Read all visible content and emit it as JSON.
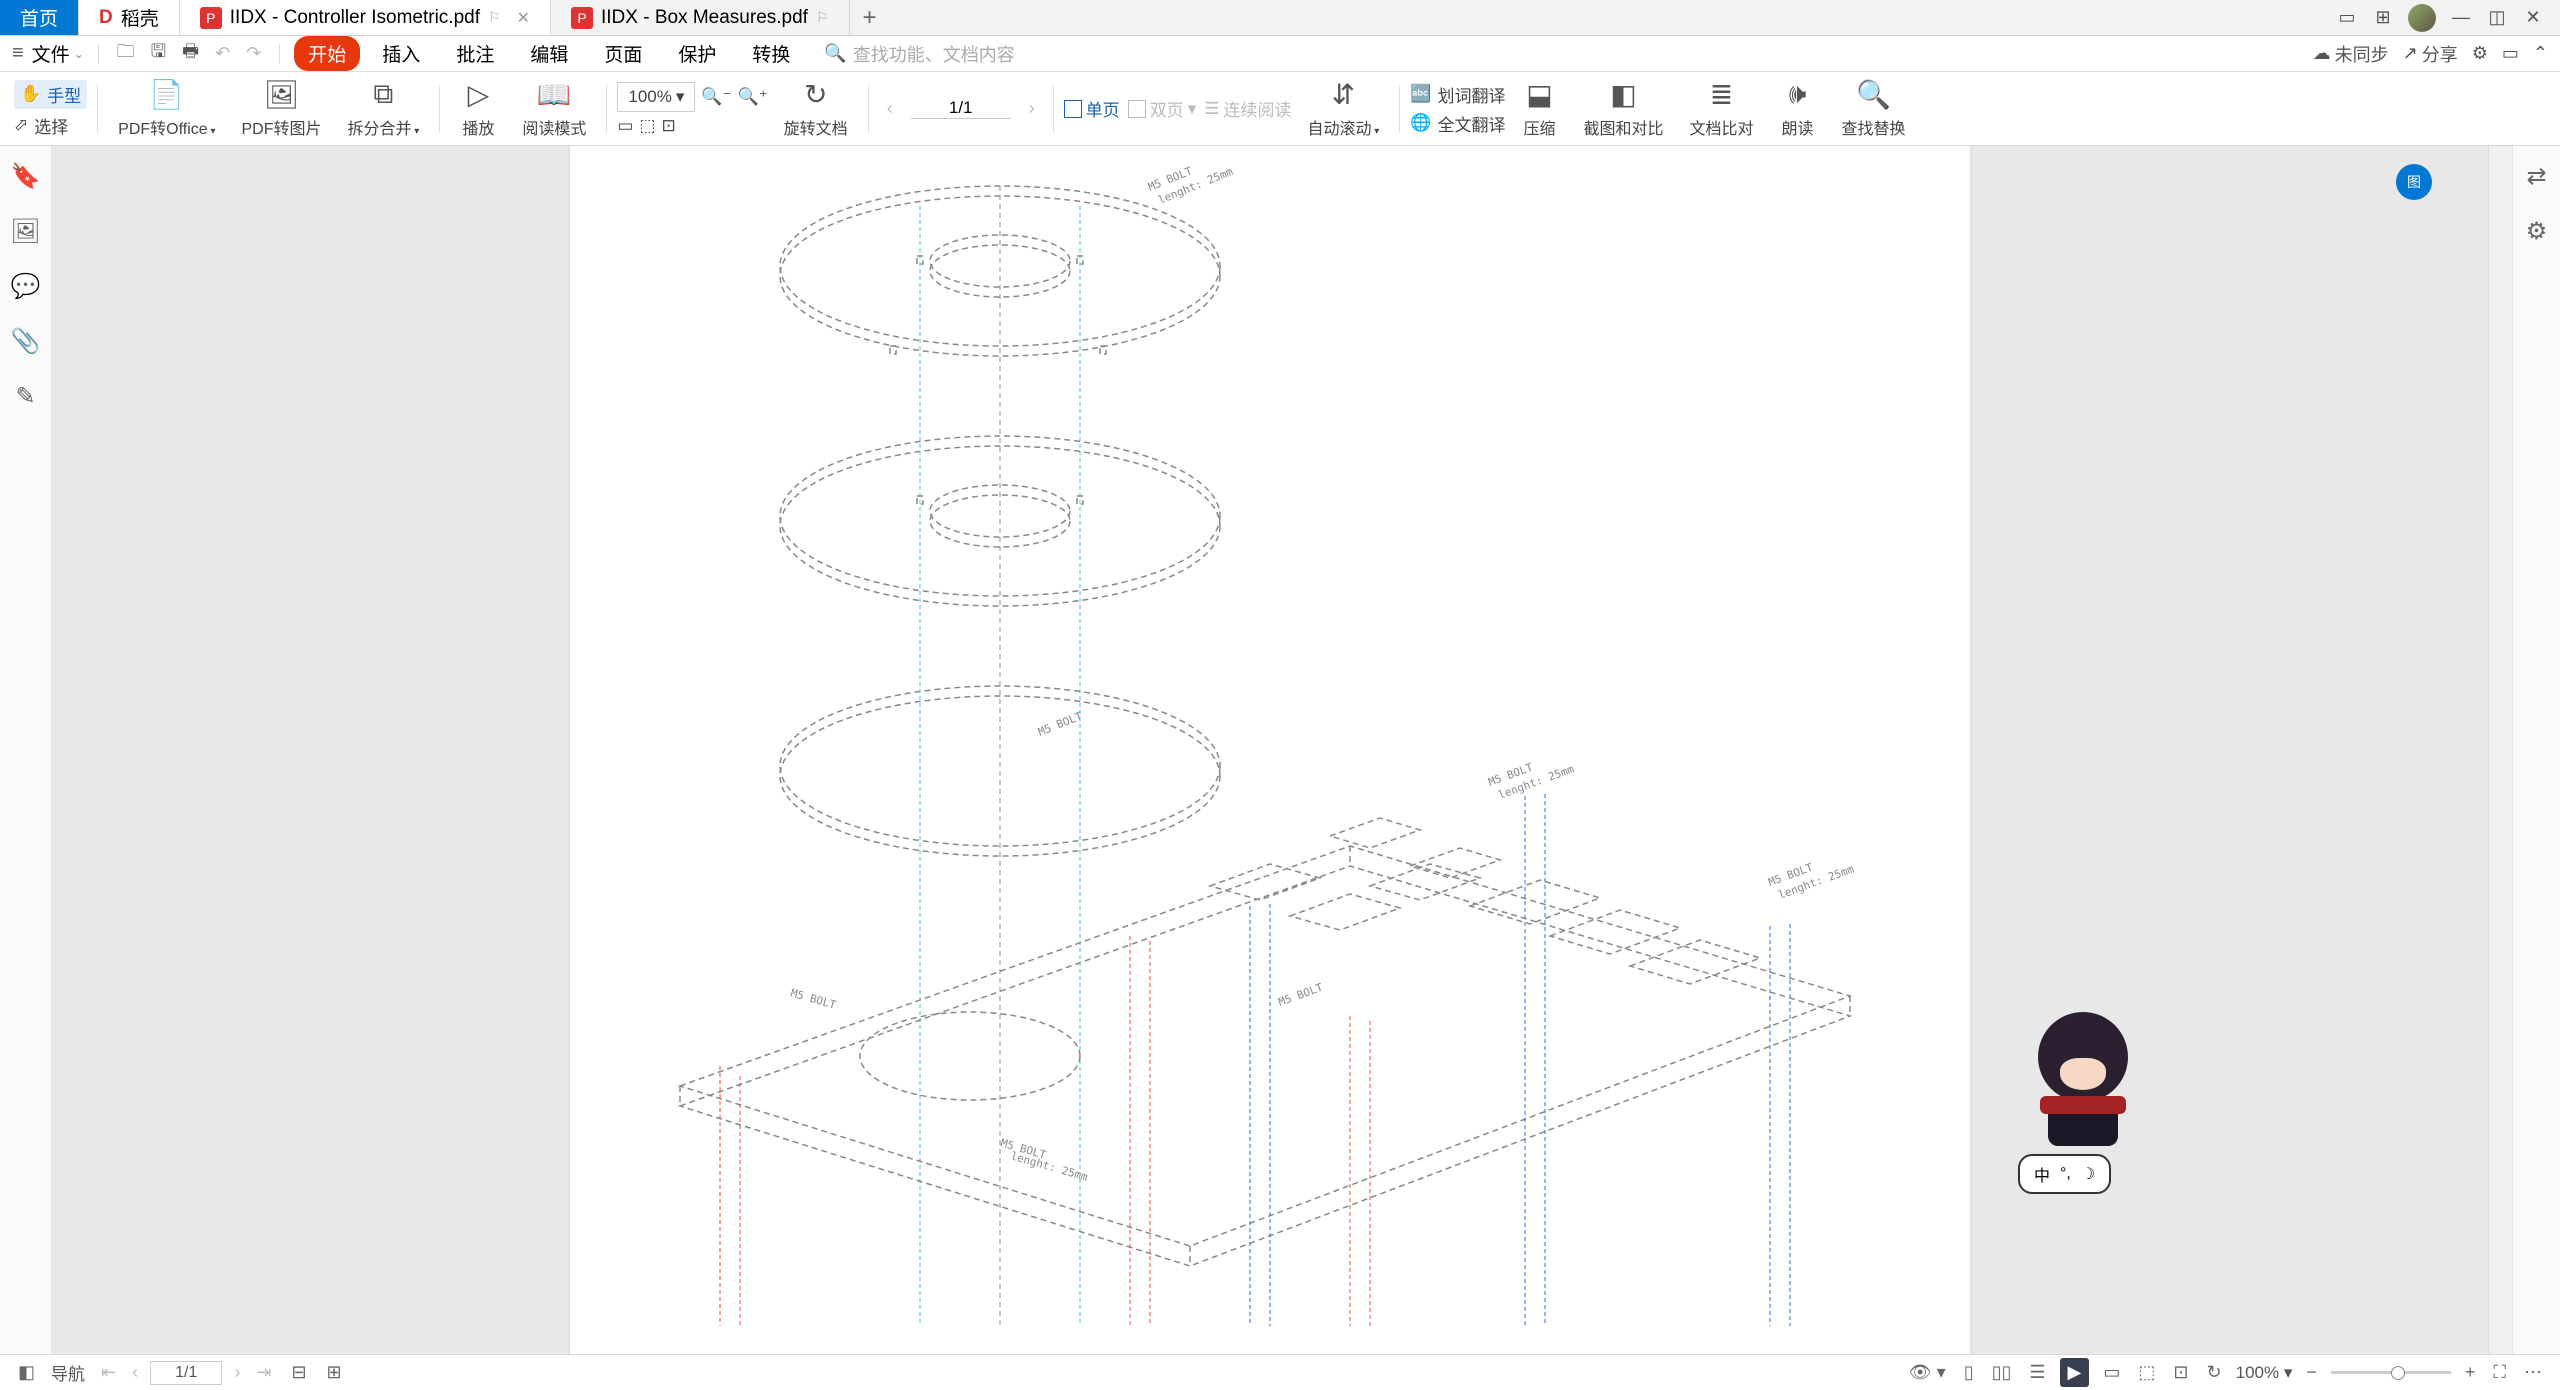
{
  "tabs": {
    "home": "首页",
    "daoke": "稻壳",
    "active": "IIDX - Controller Isometric.pdf",
    "other": "IIDX - Box Measures.pdf"
  },
  "menubar": {
    "file": "文件",
    "items": [
      "开始",
      "插入",
      "批注",
      "编辑",
      "页面",
      "保护",
      "转换"
    ],
    "search_placeholder": "查找功能、文档内容",
    "sync": "未同步",
    "share": "分享"
  },
  "toolbar": {
    "hand": "手型",
    "select": "选择",
    "pdf_to_office": "PDF转Office",
    "pdf_to_image": "PDF转图片",
    "split_merge": "拆分合并",
    "play": "播放",
    "reading_mode": "阅读模式",
    "zoom": "100%",
    "rotate": "旋转文档",
    "page_indicator": "1/1",
    "single_page": "单页",
    "double_page": "双页",
    "continuous": "连续阅读",
    "auto_scroll": "自动滚动",
    "word_translate": "划词翻译",
    "full_translate": "全文翻译",
    "compress": "压缩",
    "screenshot_compare": "截图和对比",
    "text_compare": "文档比对",
    "read_aloud": "朗读",
    "find_replace": "查找替换"
  },
  "statusbar": {
    "nav": "导航",
    "page": "1/1",
    "zoom": "100%"
  },
  "ime": {
    "lang": "中",
    "punct": "°,",
    "mode_icon": "☽"
  },
  "drawing": {
    "bolt_label": "M5 BOLT",
    "length_label": "lenght: 25mm"
  }
}
